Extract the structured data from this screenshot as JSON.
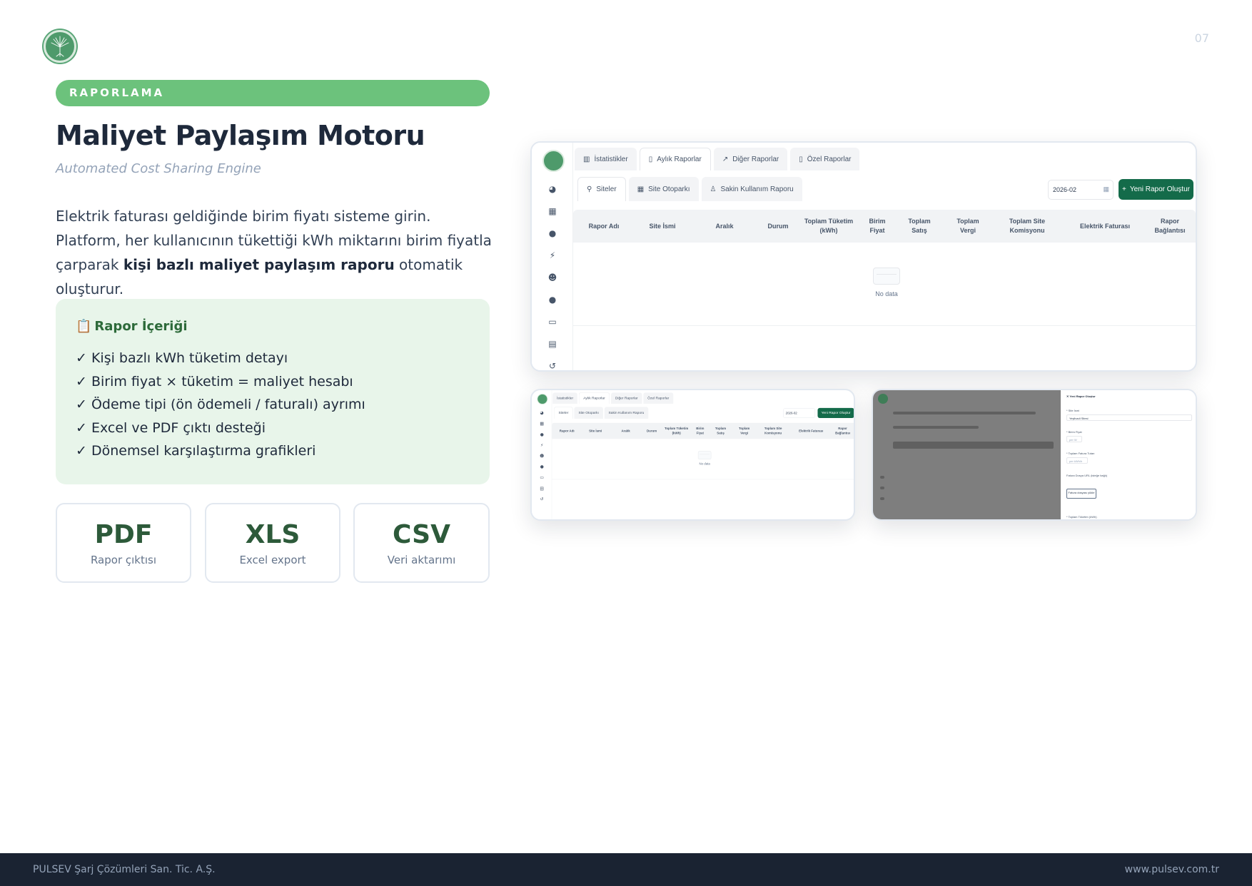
{
  "page": {
    "number": "07",
    "section_tag": "RAPORLAMA",
    "title": "Maliyet Paylaşım Motoru",
    "subtitle": "Automated Cost Sharing Engine",
    "description_part1": "Elektrik faturası geldiğinde birim fiyatı sisteme girin. Platform, her kullanıcının tükettiği kWh miktarını birim fiyatla çarparak ",
    "description_bold": "kişi bazlı maliyet paylaşım raporu",
    "description_part2": " otomatik oluşturur."
  },
  "report_content": {
    "icon": "clipboard-icon",
    "title": "Rapor İçeriği",
    "items": [
      "✓ Kişi bazlı kWh tüketim detayı",
      "✓ Birim fiyat × tüketim = maliyet hesabı",
      "✓ Ödeme tipi (ön ödemeli / faturalı) ayrımı",
      "✓ Excel ve PDF çıktı desteği",
      "✓ Dönemsel karşılaştırma grafikleri"
    ]
  },
  "formats": [
    {
      "ext": "PDF",
      "label": "Rapor çıktısı"
    },
    {
      "ext": "XLS",
      "label": "Excel export"
    },
    {
      "ext": "CSV",
      "label": "Veri aktarımı"
    }
  ],
  "app": {
    "top_tabs": [
      "İstatistikler",
      "Aylık Raporlar",
      "Diğer Raporlar",
      "Özel Raporlar"
    ],
    "sub_tabs": [
      "Siteler",
      "Site Otoparkı",
      "Sakin Kullanım Raporu"
    ],
    "date_value": "2026-02",
    "new_report_button": "Yeni Rapor Oluştur",
    "columns": [
      "Rapor Adı",
      "Site İsmi",
      "Aralık",
      "Durum",
      "Toplam Tüketim (kWh)",
      "Birim Fiyat",
      "Toplam Satış",
      "Toplam Vergi",
      "Toplam Site Komisyonu",
      "Elektrik Faturası",
      "Rapor Bağlantısı"
    ],
    "empty_text": "No data",
    "side_icons": [
      "pie-chart-icon",
      "building-icon",
      "location-pin-icon",
      "charger-icon",
      "users-icon",
      "user-icon",
      "credit-card-icon",
      "receipt-icon",
      "history-icon"
    ]
  },
  "drawer": {
    "title": "Yeni Rapor Oluştur",
    "field_site": "Site İsmi",
    "field_site_value": "Yeşilvadi Sitesi",
    "field_price": "Birim Fiyat",
    "field_price_placeholder": "per W",
    "field_invoice": "Toplam Fatura Tutarı",
    "field_invoice_placeholder": "per kWh/h",
    "field_upload": "Fatura Dosya URL (isteğe bağlı)",
    "upload_button": "Fatura dosyası yükle",
    "field_total": "Toplam Tüketim (kWh)"
  },
  "footer": {
    "company": "PULSEV Şarj Çözümleri San. Tic. A.Ş.",
    "website": "www.pulsev.com.tr"
  },
  "colors": {
    "accent_green": "#6cc27c",
    "dark_green": "#2d5a3a",
    "button_green": "#146b4a",
    "content_bg": "#e8f5ea",
    "footer_bg": "#1a2332"
  }
}
